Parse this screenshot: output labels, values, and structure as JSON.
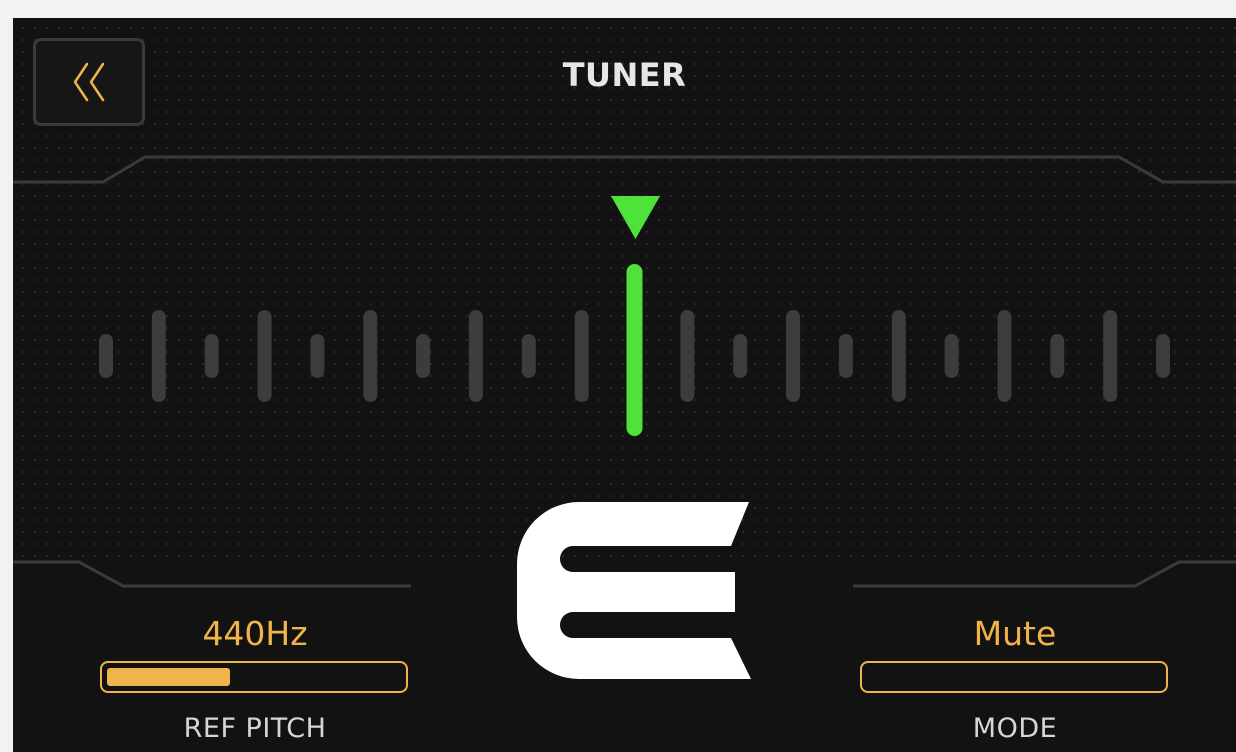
{
  "header": {
    "title": "TUNER",
    "back_icon": "double-chevron-left-icon"
  },
  "tuner": {
    "note": "E",
    "in_tune": true,
    "indicator_icon": "triangle-down-icon",
    "tick_count": 21
  },
  "ref_pitch": {
    "value": "440Hz",
    "label": "REF PITCH",
    "fill_fraction": 0.42
  },
  "mode": {
    "value": "Mute",
    "label": "MODE",
    "fill_fraction": 0
  },
  "colors": {
    "accent": "#f0b44a",
    "in_tune": "#4ee23b",
    "tick": "#3c3c3c",
    "frame": "#3a3a3a",
    "note": "#ffffff"
  }
}
